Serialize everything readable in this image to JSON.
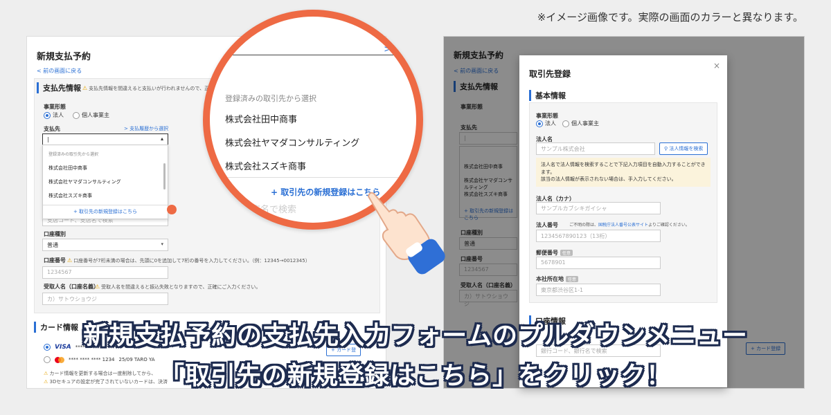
{
  "note": "※イメージ画像です。実際の画面のカラーと異なります。",
  "left": {
    "title": "新規支払予約",
    "back": "< 前の画面に戻る",
    "section1": "支払先情報",
    "section1_warning": "支払先情報を間違えると支払いが行われませんので、正確に",
    "entity_label": "事業形態",
    "entity_options": [
      "法人",
      "個人事業主"
    ],
    "payee_label": "支払先",
    "history_link": "> 支払履歴から選択",
    "dropdown": {
      "header": "登録済みの取引先から選択",
      "items": [
        "株式会社田中商事",
        "株式会社ヤマダコンサルティング",
        "株式会社スズキ商事"
      ],
      "add": "+ 取引先の新規登録はこちら"
    },
    "hidden_placeholder": "支店コード、支店名で検索",
    "account_type_label": "口座種別",
    "account_type_value": "普通",
    "account_no_label": "口座番号",
    "account_no_warning": "口座番号が7桁未満の場合は、先頭に0を追加して7桁の番号を入力してください。（例：12345→0012345）",
    "account_no_placeholder": "1234567",
    "recipient_label": "受取人名（口座名義）",
    "recipient_warning": "受取人名を間違えると振込失敗となりますので、正確にご入力ください。",
    "recipient_placeholder": "カ）サトウショウジ",
    "section2": "カード情報",
    "cards": [
      {
        "brand": "VISA",
        "number": "**** **** ****",
        "extra": ""
      },
      {
        "brand": "mastercard",
        "number": "**** **** **** 1234",
        "extra": "25/09  TARO YA"
      }
    ],
    "card_add": "+ カード登",
    "card_notes": [
      "カード情報を更新する場合は一度削除してから、",
      "3Dセキュアの設定が完了されていないカードは、決済"
    ]
  },
  "magnifier": {
    "top_link": ">",
    "header": "登録済みの取引先から選択",
    "items": [
      "株式会社田中商事",
      "株式会社ヤマダコンサルティング",
      "株式会社スズキ商事"
    ],
    "add": "+ 取引先の新規登録はこちら",
    "ghost": "店名で検索"
  },
  "right": {
    "bg_title": "新規支払予約",
    "bg_back": "< 前の画面に戻る",
    "bg_section1": "支払先情報",
    "bg_entity_label": "事業形態",
    "bg_payee_label": "支払先",
    "bg_items": [
      "株式会社田中商事",
      "株式会社ヤマダコンサルティング",
      "株式会社スズキ商事"
    ],
    "bg_add": "+ 取引先の新規登録はこちら",
    "bg_account_type_label": "口座種別",
    "bg_account_type_value": "普通",
    "bg_account_no_label": "口座番号",
    "bg_account_no_placeholder": "1234567",
    "bg_recipient_label": "受取人名（口座名義）",
    "bg_recipient_placeholder": "カ）サトウショウジ",
    "bg_card_add": "+ カード登録",
    "modal": {
      "title": "取引先登録",
      "close": "×",
      "section": "基本情報",
      "entity_label": "事業形態",
      "entity_options": [
        "法人",
        "個人事業主"
      ],
      "corp_name_label": "法人名",
      "corp_name_placeholder": "サンプル株式会社",
      "search_button": "法人情報を検索",
      "info": [
        "法人名で法人情報を検索することで下記入力項目を自動入力することができます。",
        "該当の法人情報が表示されない場合は、手入力してください。"
      ],
      "kana_label": "法人名（カナ）",
      "kana_placeholder": "サンプルカブシキガイシャ",
      "corp_no_label": "法人番号",
      "corp_no_hint_pre": "ご不明の際は、",
      "corp_no_hint_link": "国税庁法人番号公表サイト",
      "corp_no_hint_post": "よりご確認ください。",
      "corp_no_placeholder": "1234567890123（13桁）",
      "postal_label": "郵便番号",
      "optional": "任意",
      "postal_placeholder": "5678901",
      "address_label": "本社所在地",
      "address_placeholder": "東京都渋谷区1-1",
      "section2": "口座情報",
      "bank_placeholder": "銀行コード、銀行名で検索"
    }
  },
  "caption": {
    "line1": "新規支払予約の支払先入力フォームのプルダウンメニュー",
    "line2": "「取引先の新規登録はこちら」をクリック！"
  }
}
